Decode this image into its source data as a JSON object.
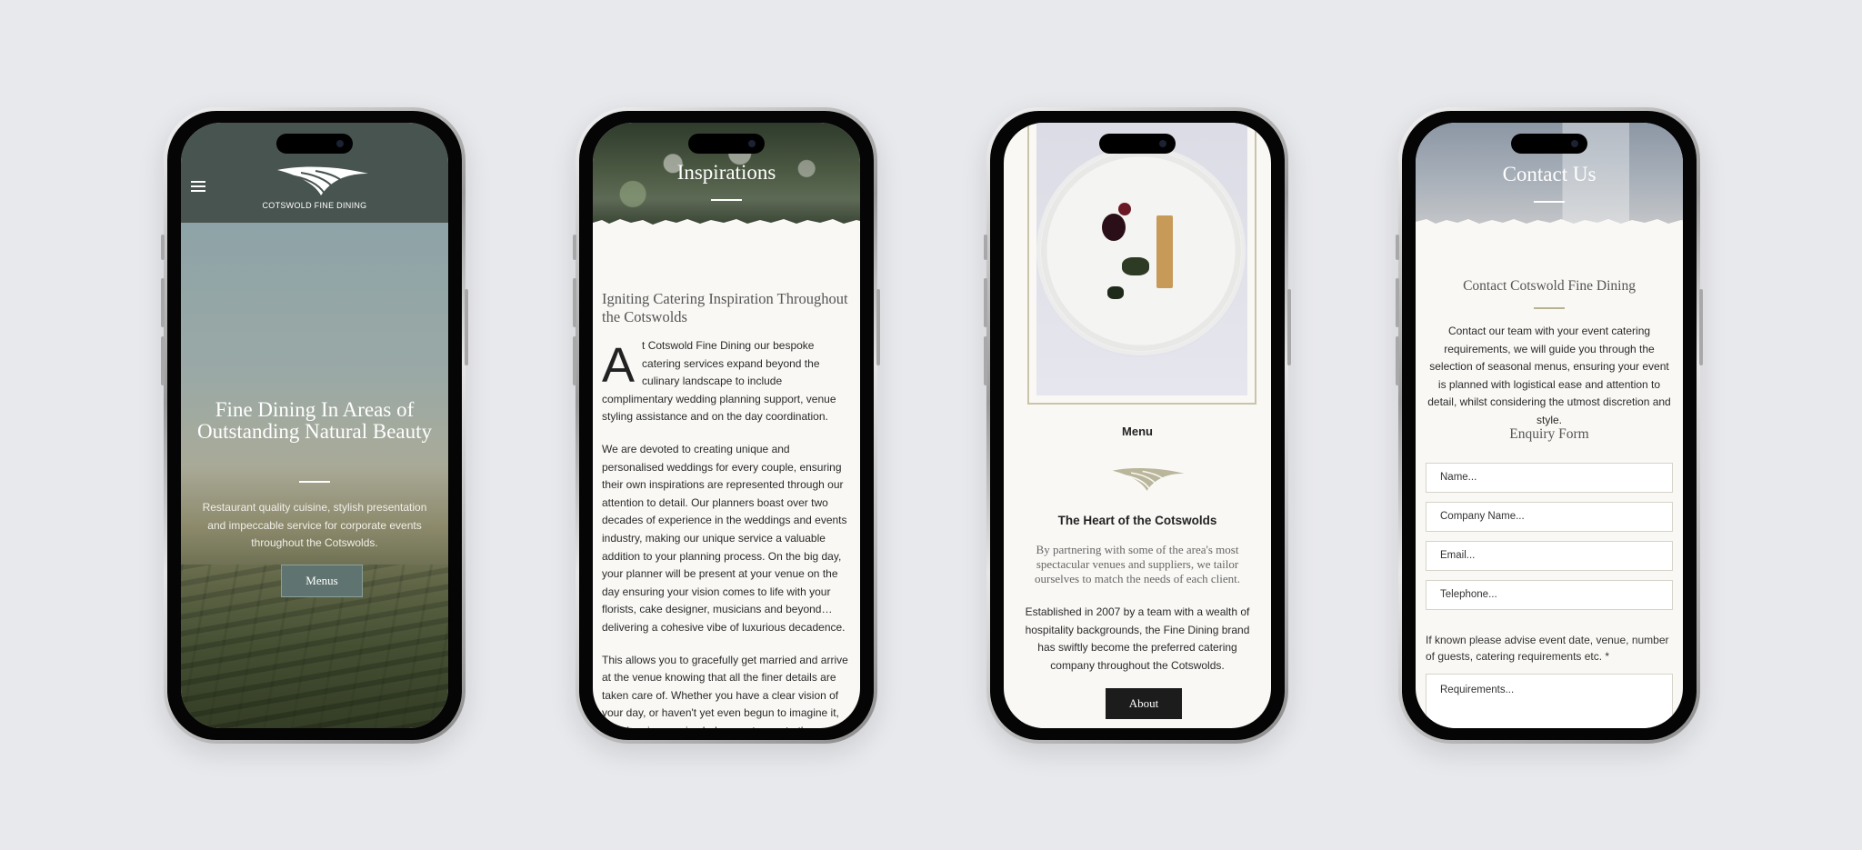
{
  "phone1": {
    "logo_text": "COTSWOLD FINE DINING",
    "hero_title": "Fine Dining In Areas of Outstanding Natural Beauty",
    "hero_subtitle": "Restaurant quality cuisine, stylish presentation and impeccable service for corporate events throughout the Cotswolds.",
    "cta_label": "Menus"
  },
  "phone2": {
    "title": "Inspirations",
    "heading": "Igniting Catering Inspiration Throughout the Cotswolds",
    "drop_cap": "A",
    "para1": "t Cotswold Fine Dining our bespoke catering services expand beyond the culinary landscape to include complimentary wedding planning support, venue styling assistance and on the day coordination.",
    "para2": "We are devoted to creating unique and personalised weddings for every couple, ensuring their own inspirations are represented through our attention to detail. Our planners boast over two decades of experience in the weddings and events industry, making our unique service a valuable addition to your planning process. On the big day, your planner will be present at your venue on the day ensuring your vision comes to life with your florists, cake designer, musicians and beyond… delivering a cohesive vibe of luxurious decadence.",
    "para3": "This allows you to gracefully get married and arrive at the venue knowing that all the finer details are taken care of. Whether you have a clear vision of your day, or haven't yet even begun to imagine it, our planning service helps you to create the perfect event. We will"
  },
  "phone3": {
    "menu_label": "Menu",
    "heading": "The Heart of the Cotswolds",
    "lead": "By partnering with some of the area's most spectacular venues and suppliers, we tailor ourselves to match the needs of each client.",
    "body": "Established in 2007 by a team with a wealth of hospitality backgrounds, the Fine Dining brand has swiftly become the preferred catering company throughout the Cotswolds.",
    "cta_label": "About"
  },
  "phone4": {
    "title": "Contact Us",
    "subheading": "Contact Cotswold Fine Dining",
    "body": "Contact our team with your event catering requirements, we will guide you through the selection of seasonal menus, ensuring your event is planned with logistical ease and attention to detail, whilst considering the utmost discretion and style.",
    "form_title": "Enquiry Form",
    "placeholders": {
      "name": "Name...",
      "company": "Company Name...",
      "email": "Email...",
      "telephone": "Telephone...",
      "requirements": "Requirements..."
    },
    "note": "If known please advise event date, venue, number of guests, catering requirements etc.  *"
  },
  "colors": {
    "page_bg": "#e8e9ed",
    "header_green": "#485450",
    "menus_button": "#5f7470",
    "about_button": "#1c1c1c",
    "accent_sage": "#b7b392"
  }
}
